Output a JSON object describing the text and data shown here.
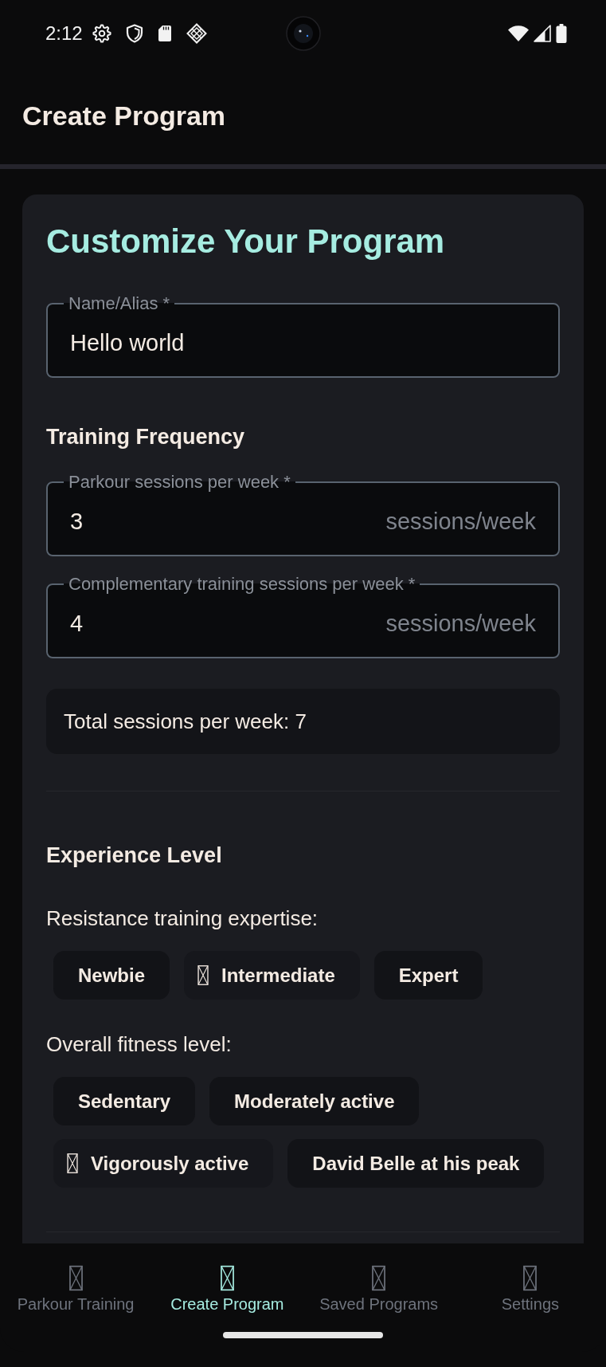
{
  "status_bar": {
    "time": "2:12"
  },
  "app_bar": {
    "title": "Create Program"
  },
  "form": {
    "title": "Customize Your Program",
    "name_field": {
      "label": "Name/Alias *",
      "value": "Hello world"
    },
    "training_frequency": {
      "heading": "Training Frequency",
      "fields": [
        {
          "label": "Parkour sessions per week *",
          "value": "3",
          "suffix": "sessions/week"
        },
        {
          "label": "Complementary training sessions per week *",
          "value": "4",
          "suffix": "sessions/week"
        }
      ],
      "total": "Total sessions per week: 7"
    },
    "experience_level": {
      "heading": "Experience Level",
      "groups": [
        {
          "label": "Resistance training expertise:",
          "options": [
            {
              "label": "Newbie",
              "selected": false
            },
            {
              "label": "Intermediate",
              "selected": true
            },
            {
              "label": "Expert",
              "selected": false
            }
          ]
        },
        {
          "label": "Overall fitness level:",
          "options": [
            {
              "label": "Sedentary",
              "selected": false
            },
            {
              "label": "Moderately active",
              "selected": false
            },
            {
              "label": "Vigorously active",
              "selected": true
            },
            {
              "label": "David Belle at his peak",
              "selected": false
            }
          ]
        }
      ]
    }
  },
  "bottom_nav": {
    "items": [
      {
        "label": "Parkour Training",
        "selected": false
      },
      {
        "label": "Create Program",
        "selected": true
      },
      {
        "label": "Saved Programs",
        "selected": false
      },
      {
        "label": "Settings",
        "selected": false
      }
    ]
  }
}
